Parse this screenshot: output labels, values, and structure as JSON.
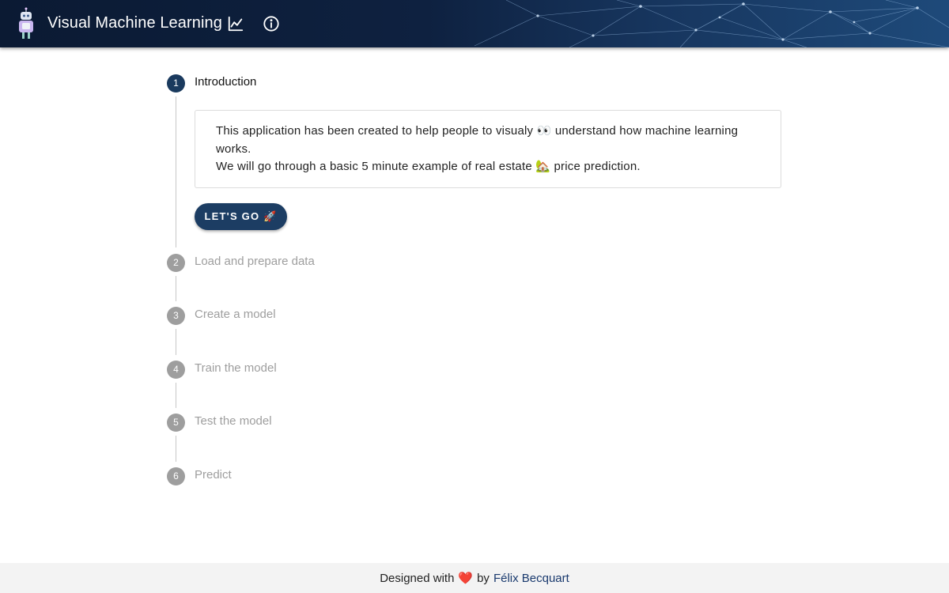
{
  "header": {
    "title": "Visual Machine Learning",
    "icons": [
      "robot-logo-icon",
      "chart-line-icon",
      "info-icon"
    ]
  },
  "stepper": {
    "steps": [
      {
        "number": "1",
        "label": "Introduction",
        "state": "active"
      },
      {
        "number": "2",
        "label": "Load and prepare data",
        "state": "inactive"
      },
      {
        "number": "3",
        "label": "Create a model",
        "state": "inactive"
      },
      {
        "number": "4",
        "label": "Train the model",
        "state": "inactive"
      },
      {
        "number": "5",
        "label": "Test the model",
        "state": "inactive"
      },
      {
        "number": "6",
        "label": "Predict",
        "state": "inactive"
      }
    ],
    "intro": {
      "line1": "This application has been created to help people to visualy 👀 understand how machine learning works.",
      "line2": "We will go through a basic 5 minute example of real estate 🏡 price prediction.",
      "button_label": "LET'S GO 🚀"
    }
  },
  "footer": {
    "prefix": "Designed with",
    "heart": "❤️",
    "by": "by",
    "author": "Félix Becquart"
  },
  "colors": {
    "header_dark": "#0b1a33",
    "accent": "#1c3d63",
    "inactive": "#9e9e9e",
    "footer_bg": "#f3f3f3"
  }
}
